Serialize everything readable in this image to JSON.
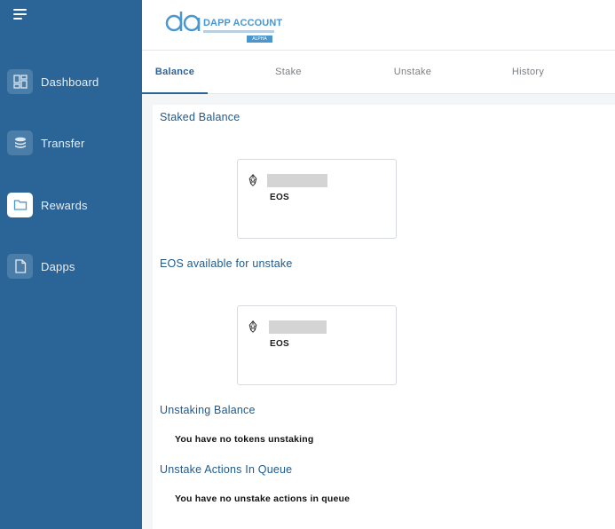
{
  "app": {
    "logo_title": "DAPP ACCOUNT",
    "logo_badge": "ALPHA"
  },
  "sidebar": {
    "items": [
      {
        "label": "Dashboard",
        "icon": "dashboard-icon",
        "active": false
      },
      {
        "label": "Transfer",
        "icon": "coins-icon",
        "active": false
      },
      {
        "label": "Rewards",
        "icon": "folder-icon",
        "active": true
      },
      {
        "label": "Dapps",
        "icon": "document-icon",
        "active": false
      }
    ]
  },
  "tabs": [
    {
      "label": "Balance",
      "active": true
    },
    {
      "label": "Stake",
      "active": false
    },
    {
      "label": "Unstake",
      "active": false
    },
    {
      "label": "History",
      "active": false
    }
  ],
  "sections": {
    "staked": {
      "title": "Staked Balance",
      "token": "EOS"
    },
    "available": {
      "title": "EOS available for unstake",
      "token": "EOS"
    },
    "unstaking": {
      "title": "Unstaking Balance",
      "message": "You have no tokens unstaking"
    },
    "queue": {
      "title": "Unstake Actions In Queue",
      "message": "You have no unstake actions in queue"
    }
  },
  "colors": {
    "sidebar": "#2b6496",
    "accent": "#4a97cf",
    "title": "#1e5a8c"
  }
}
